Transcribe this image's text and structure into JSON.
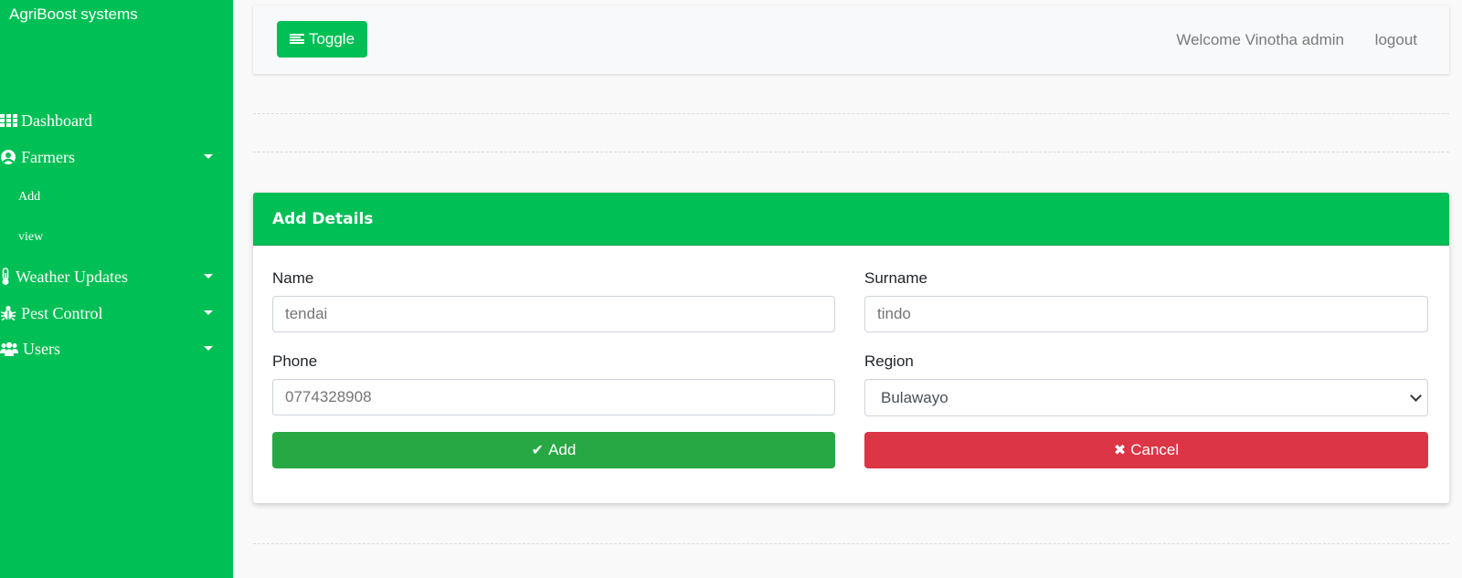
{
  "sidebar": {
    "brand": "AgriBoost systems",
    "items": [
      {
        "label": "Dashboard",
        "icon": "grid-icon"
      },
      {
        "label": "Farmers",
        "icon": "user-circle-icon",
        "expanded": true,
        "children": [
          {
            "label": "Add"
          },
          {
            "label": "view"
          }
        ]
      },
      {
        "label": "Weather Updates",
        "icon": "thermometer-icon"
      },
      {
        "label": "Pest Control",
        "icon": "bug-icon"
      },
      {
        "label": "Users",
        "icon": "users-icon"
      }
    ]
  },
  "topbar": {
    "toggle_label": "Toggle",
    "welcome": "Welcome Vinotha admin",
    "logout": "logout"
  },
  "form": {
    "title": "Add Details",
    "name_label": "Name",
    "name_placeholder": "tendai",
    "surname_label": "Surname",
    "surname_placeholder": "tindo",
    "phone_label": "Phone",
    "phone_placeholder": "0774328908",
    "region_label": "Region",
    "region_value": "Bulawayo",
    "add_label": "Add",
    "cancel_label": "Cancel"
  },
  "colors": {
    "brand_green": "#00bf55",
    "add_green": "#28a745",
    "cancel_red": "#dc3545"
  }
}
